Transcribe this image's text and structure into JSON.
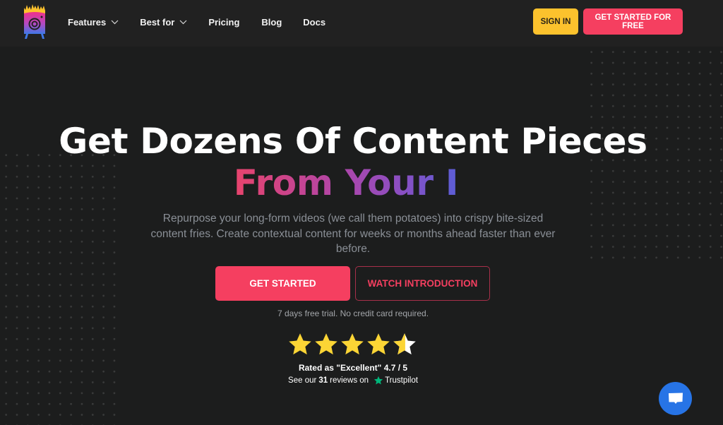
{
  "brand": {
    "name": "Content Fries",
    "logo_icon": "fries-camera-logo"
  },
  "nav": {
    "items": [
      {
        "label": "Features",
        "has_dropdown": true
      },
      {
        "label": "Best for",
        "has_dropdown": true
      },
      {
        "label": "Pricing",
        "has_dropdown": false
      },
      {
        "label": "Blog",
        "has_dropdown": false
      },
      {
        "label": "Docs",
        "has_dropdown": false
      }
    ],
    "sign_in_label": "SIGN IN",
    "get_started_free_label": "GET STARTED FOR FREE"
  },
  "hero": {
    "title": "Get Dozens Of Content Pieces",
    "subtitle": "From Your I",
    "description": "Repurpose your long-form videos (we call them potatoes) into crispy bite-sized content fries. Create contextual content for weeks or months ahead faster than ever before.",
    "primary_cta": "GET STARTED",
    "secondary_cta": "WATCH INTRODUCTION",
    "trial_note": "7 days free trial. No credit card required."
  },
  "rating": {
    "score": 4.7,
    "max": 5,
    "stars_filled_fraction": 0.94,
    "rated_text": "Rated as \"Excellent\" 4.7 / 5",
    "reviews_prefix": "See our",
    "reviews_count": "31",
    "reviews_suffix": "reviews on",
    "platform": "Trustpilot"
  },
  "chat": {
    "icon": "chat-icon"
  },
  "colors": {
    "background": "#1c1d1d",
    "navbar": "#212121",
    "accent": "#f53f60",
    "sign_in": "#fcc22d",
    "star": "#fcd535",
    "trustpilot": "#00b67a",
    "chat": "#2774e6"
  }
}
